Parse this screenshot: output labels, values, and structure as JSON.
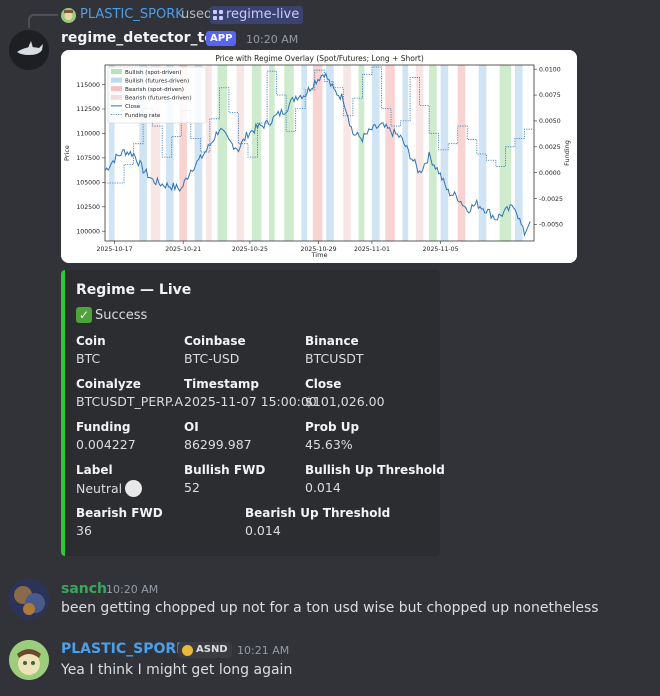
{
  "reply": {
    "user": "PLASTIC_SPORK",
    "used_text": "used",
    "command": "regime-live"
  },
  "bot_message": {
    "author": "regime_detector_test",
    "badge": "APP",
    "time": "10:20 AM"
  },
  "chart": {
    "title": "Price with Regime Overlay (Spot/Futures; Long + Short)",
    "xlabel": "Time",
    "ylabel_left": "Price",
    "ylabel_right": "Funding",
    "legend": [
      {
        "label": "Bullish (spot-driven)",
        "color": "#b9e3b9"
      },
      {
        "label": "Bullish (futures-driven)",
        "color": "#bcd9ef"
      },
      {
        "label": "Bearish (spot-driven)",
        "color": "#f5c0bd"
      },
      {
        "label": "Bearish (futures-driven)",
        "color": "#f3dcdc"
      },
      {
        "label": "Close",
        "color": "#2f74b5"
      },
      {
        "label": "Funding rate",
        "color": "#2f74b5"
      }
    ]
  },
  "chart_data": {
    "type": "line",
    "title": "Price with Regime Overlay (Spot/Futures; Long + Short)",
    "xlabel": "Time",
    "ylabel": "Price",
    "y2label": "Funding",
    "x_ticks": [
      "2025-10-17",
      "2025-10-21",
      "2025-10-25",
      "2025-10-29",
      "2025-11-01",
      "2025-11-05"
    ],
    "y_ticks": [
      "100000",
      "102500",
      "105000",
      "107500",
      "110000",
      "112500",
      "115000"
    ],
    "y2_ticks": [
      "-0.0050",
      "-0.0025",
      "0.0000",
      "0.0025",
      "0.0050",
      "0.0075",
      "0.0100"
    ],
    "ylim": [
      99000,
      117000
    ],
    "y2lim": [
      -0.0066,
      0.0104
    ],
    "xlim": [
      0,
      22.5
    ],
    "close": {
      "x": [
        0,
        0.5,
        1,
        1.5,
        2,
        2.5,
        3,
        3.5,
        4,
        4.5,
        5,
        5.5,
        6,
        6.5,
        7,
        7.5,
        8,
        8.5,
        9,
        9.5,
        10,
        10.5,
        11,
        11.5,
        12,
        12.5,
        13,
        13.5,
        14,
        14.5,
        15,
        15.5,
        16,
        16.5,
        17,
        17.5,
        18,
        18.5,
        19,
        19.5,
        20,
        20.5,
        21,
        21.5,
        22
      ],
      "y": [
        106200,
        107400,
        108200,
        107900,
        106300,
        105200,
        104800,
        104600,
        104300,
        106300,
        107400,
        108800,
        110500,
        109200,
        108400,
        110000,
        110600,
        111000,
        111800,
        112500,
        113800,
        114000,
        115300,
        116200,
        114400,
        113600,
        110000,
        109500,
        110400,
        110800,
        110200,
        109600,
        107800,
        106000,
        107700,
        106100,
        104000,
        103500,
        102200,
        102800,
        102200,
        101300,
        102000,
        102600,
        99600
      ]
    },
    "funding": {
      "x": [
        0,
        1,
        1.5,
        2,
        2.5,
        3,
        3.5,
        4,
        4.5,
        5,
        5.5,
        6,
        6.5,
        7,
        7.5,
        8,
        8.5,
        9,
        9.5,
        10,
        10.5,
        11,
        11.5,
        12,
        12.5,
        13,
        13.5,
        14,
        14.5,
        15,
        15.5,
        16,
        16.5,
        17,
        17.5,
        18,
        18.5,
        19,
        19.5,
        20,
        20.5,
        21,
        21.5,
        22
      ],
      "y": [
        -0.001,
        0.0008,
        0.0028,
        0.0062,
        0.0045,
        0.0015,
        0.0035,
        0.006,
        0.0033,
        0.002,
        0.0052,
        0.0082,
        0.0058,
        0.0028,
        0.0015,
        0.0048,
        0.0098,
        0.0075,
        0.004,
        0.0062,
        0.008,
        0.0099,
        0.0088,
        0.0082,
        0.0055,
        0.0072,
        0.0095,
        0.0102,
        0.0062,
        0.0045,
        0.005,
        0.0092,
        0.0065,
        0.0038,
        0.0022,
        0.0028,
        0.0045,
        0.0032,
        0.0018,
        0.0012,
        0.0006,
        0.0025,
        0.0033,
        0.0042
      ]
    },
    "regimes": [
      {
        "type": "bull_futures",
        "x0": 0.2,
        "x1": 0.5
      },
      {
        "type": "bull_futures",
        "x0": 1.8,
        "x1": 2.2
      },
      {
        "type": "bear_futures",
        "x0": 2.4,
        "x1": 2.9
      },
      {
        "type": "bull_futures",
        "x0": 3.2,
        "x1": 3.6
      },
      {
        "type": "bear_spot",
        "x0": 3.9,
        "x1": 4.3
      },
      {
        "type": "bull_futures",
        "x0": 4.7,
        "x1": 5.1
      },
      {
        "type": "bear_futures",
        "x0": 5.3,
        "x1": 5.6
      },
      {
        "type": "bull_spot",
        "x0": 5.9,
        "x1": 6.4
      },
      {
        "type": "bear_futures",
        "x0": 6.9,
        "x1": 7.3
      },
      {
        "type": "bull_spot",
        "x0": 7.7,
        "x1": 8.2
      },
      {
        "type": "bull_spot",
        "x0": 8.6,
        "x1": 8.9
      },
      {
        "type": "bull_spot",
        "x0": 9.4,
        "x1": 9.9
      },
      {
        "type": "bull_futures",
        "x0": 10.3,
        "x1": 10.6
      },
      {
        "type": "bear_spot",
        "x0": 10.9,
        "x1": 11.4
      },
      {
        "type": "bull_futures",
        "x0": 11.6,
        "x1": 12.0
      },
      {
        "type": "bear_futures",
        "x0": 12.5,
        "x1": 12.9
      },
      {
        "type": "bull_spot",
        "x0": 13.3,
        "x1": 13.6
      },
      {
        "type": "bull_futures",
        "x0": 14.0,
        "x1": 14.4
      },
      {
        "type": "bear_spot",
        "x0": 14.7,
        "x1": 15.2
      },
      {
        "type": "bull_futures",
        "x0": 15.6,
        "x1": 15.9
      },
      {
        "type": "bear_futures",
        "x0": 16.3,
        "x1": 16.7
      },
      {
        "type": "bull_spot",
        "x0": 17.0,
        "x1": 17.4
      },
      {
        "type": "bull_futures",
        "x0": 17.6,
        "x1": 18.0
      },
      {
        "type": "bear_spot",
        "x0": 18.5,
        "x1": 18.9
      },
      {
        "type": "bull_futures",
        "x0": 19.6,
        "x1": 20.0
      },
      {
        "type": "bull_spot",
        "x0": 20.7,
        "x1": 21.3
      },
      {
        "type": "bull_futures",
        "x0": 21.5,
        "x1": 21.9
      }
    ],
    "grid": false,
    "legend_position": "top-left"
  },
  "embed": {
    "title": "Regime — Live",
    "status": "Success",
    "accent": "#2dc936",
    "fields": [
      {
        "name": "Coin",
        "value": "BTC"
      },
      {
        "name": "Coinbase",
        "value": "BTC-USD"
      },
      {
        "name": "Binance",
        "value": "BTCUSDT"
      },
      {
        "name": "Coinalyze",
        "value": "BTCUSDT_PERP.A"
      },
      {
        "name": "Timestamp",
        "value": "2025-11-07 15:00:00"
      },
      {
        "name": "Close",
        "value": "$101,026.00"
      },
      {
        "name": "Funding",
        "value": "0.004227"
      },
      {
        "name": "OI",
        "value": "86299.987"
      },
      {
        "name": "Prob Up",
        "value": "45.63%"
      },
      {
        "name": "Label",
        "value": "Neutral"
      },
      {
        "name": "Bullish FWD",
        "value": "52"
      },
      {
        "name": "Bullish Up Threshold",
        "value": "0.014"
      },
      {
        "name": "Bearish FWD",
        "value": "36"
      },
      {
        "name": "Bearish Up Threshold",
        "value": "0.014"
      }
    ]
  },
  "messages": [
    {
      "author": "sanch",
      "time": "10:20 AM",
      "text": "been getting chopped up not for a ton usd wise but chopped up nonetheless",
      "name_color": "#3ba55c"
    },
    {
      "author": "PLASTIC_SPORK",
      "badge": "ASND",
      "time": "10:21 AM",
      "text": "Yea I think I might get long again",
      "name_color": "#4f9fe8"
    }
  ]
}
